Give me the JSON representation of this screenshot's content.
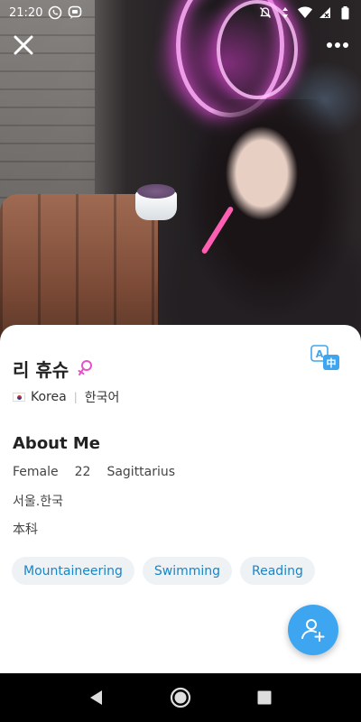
{
  "status_bar": {
    "time": "21:20",
    "left_icons": [
      "whatsapp-icon",
      "chat-bubble-icon"
    ],
    "right_icons": [
      "notifications-off-icon",
      "data-arrows-icon",
      "wifi-icon",
      "signal-icon",
      "battery-icon"
    ]
  },
  "top_actions": {
    "close_icon": "close-icon",
    "more_icon": "more-dots-icon"
  },
  "profile": {
    "name": "리 휴슈",
    "gender_icon": "female-icon",
    "gender_color": "#e653c8",
    "country": "Korea",
    "language": "한국어",
    "translate_icon": "translate-icon"
  },
  "about": {
    "title": "About Me",
    "gender": "Female",
    "age": "22",
    "zodiac": "Sagittarius",
    "city": "서울.한국",
    "education": "本科"
  },
  "interests": [
    "Mountaineering",
    "Swimming",
    "Reading"
  ],
  "fab": {
    "icon": "add-friend-icon",
    "color": "#3ea6f0"
  },
  "nav": {
    "icons": [
      "back-icon",
      "home-icon",
      "recents-icon"
    ]
  },
  "colors": {
    "tag_text": "#1a84c6",
    "tag_bg": "#eef2f5",
    "accent": "#3ea6f0"
  }
}
